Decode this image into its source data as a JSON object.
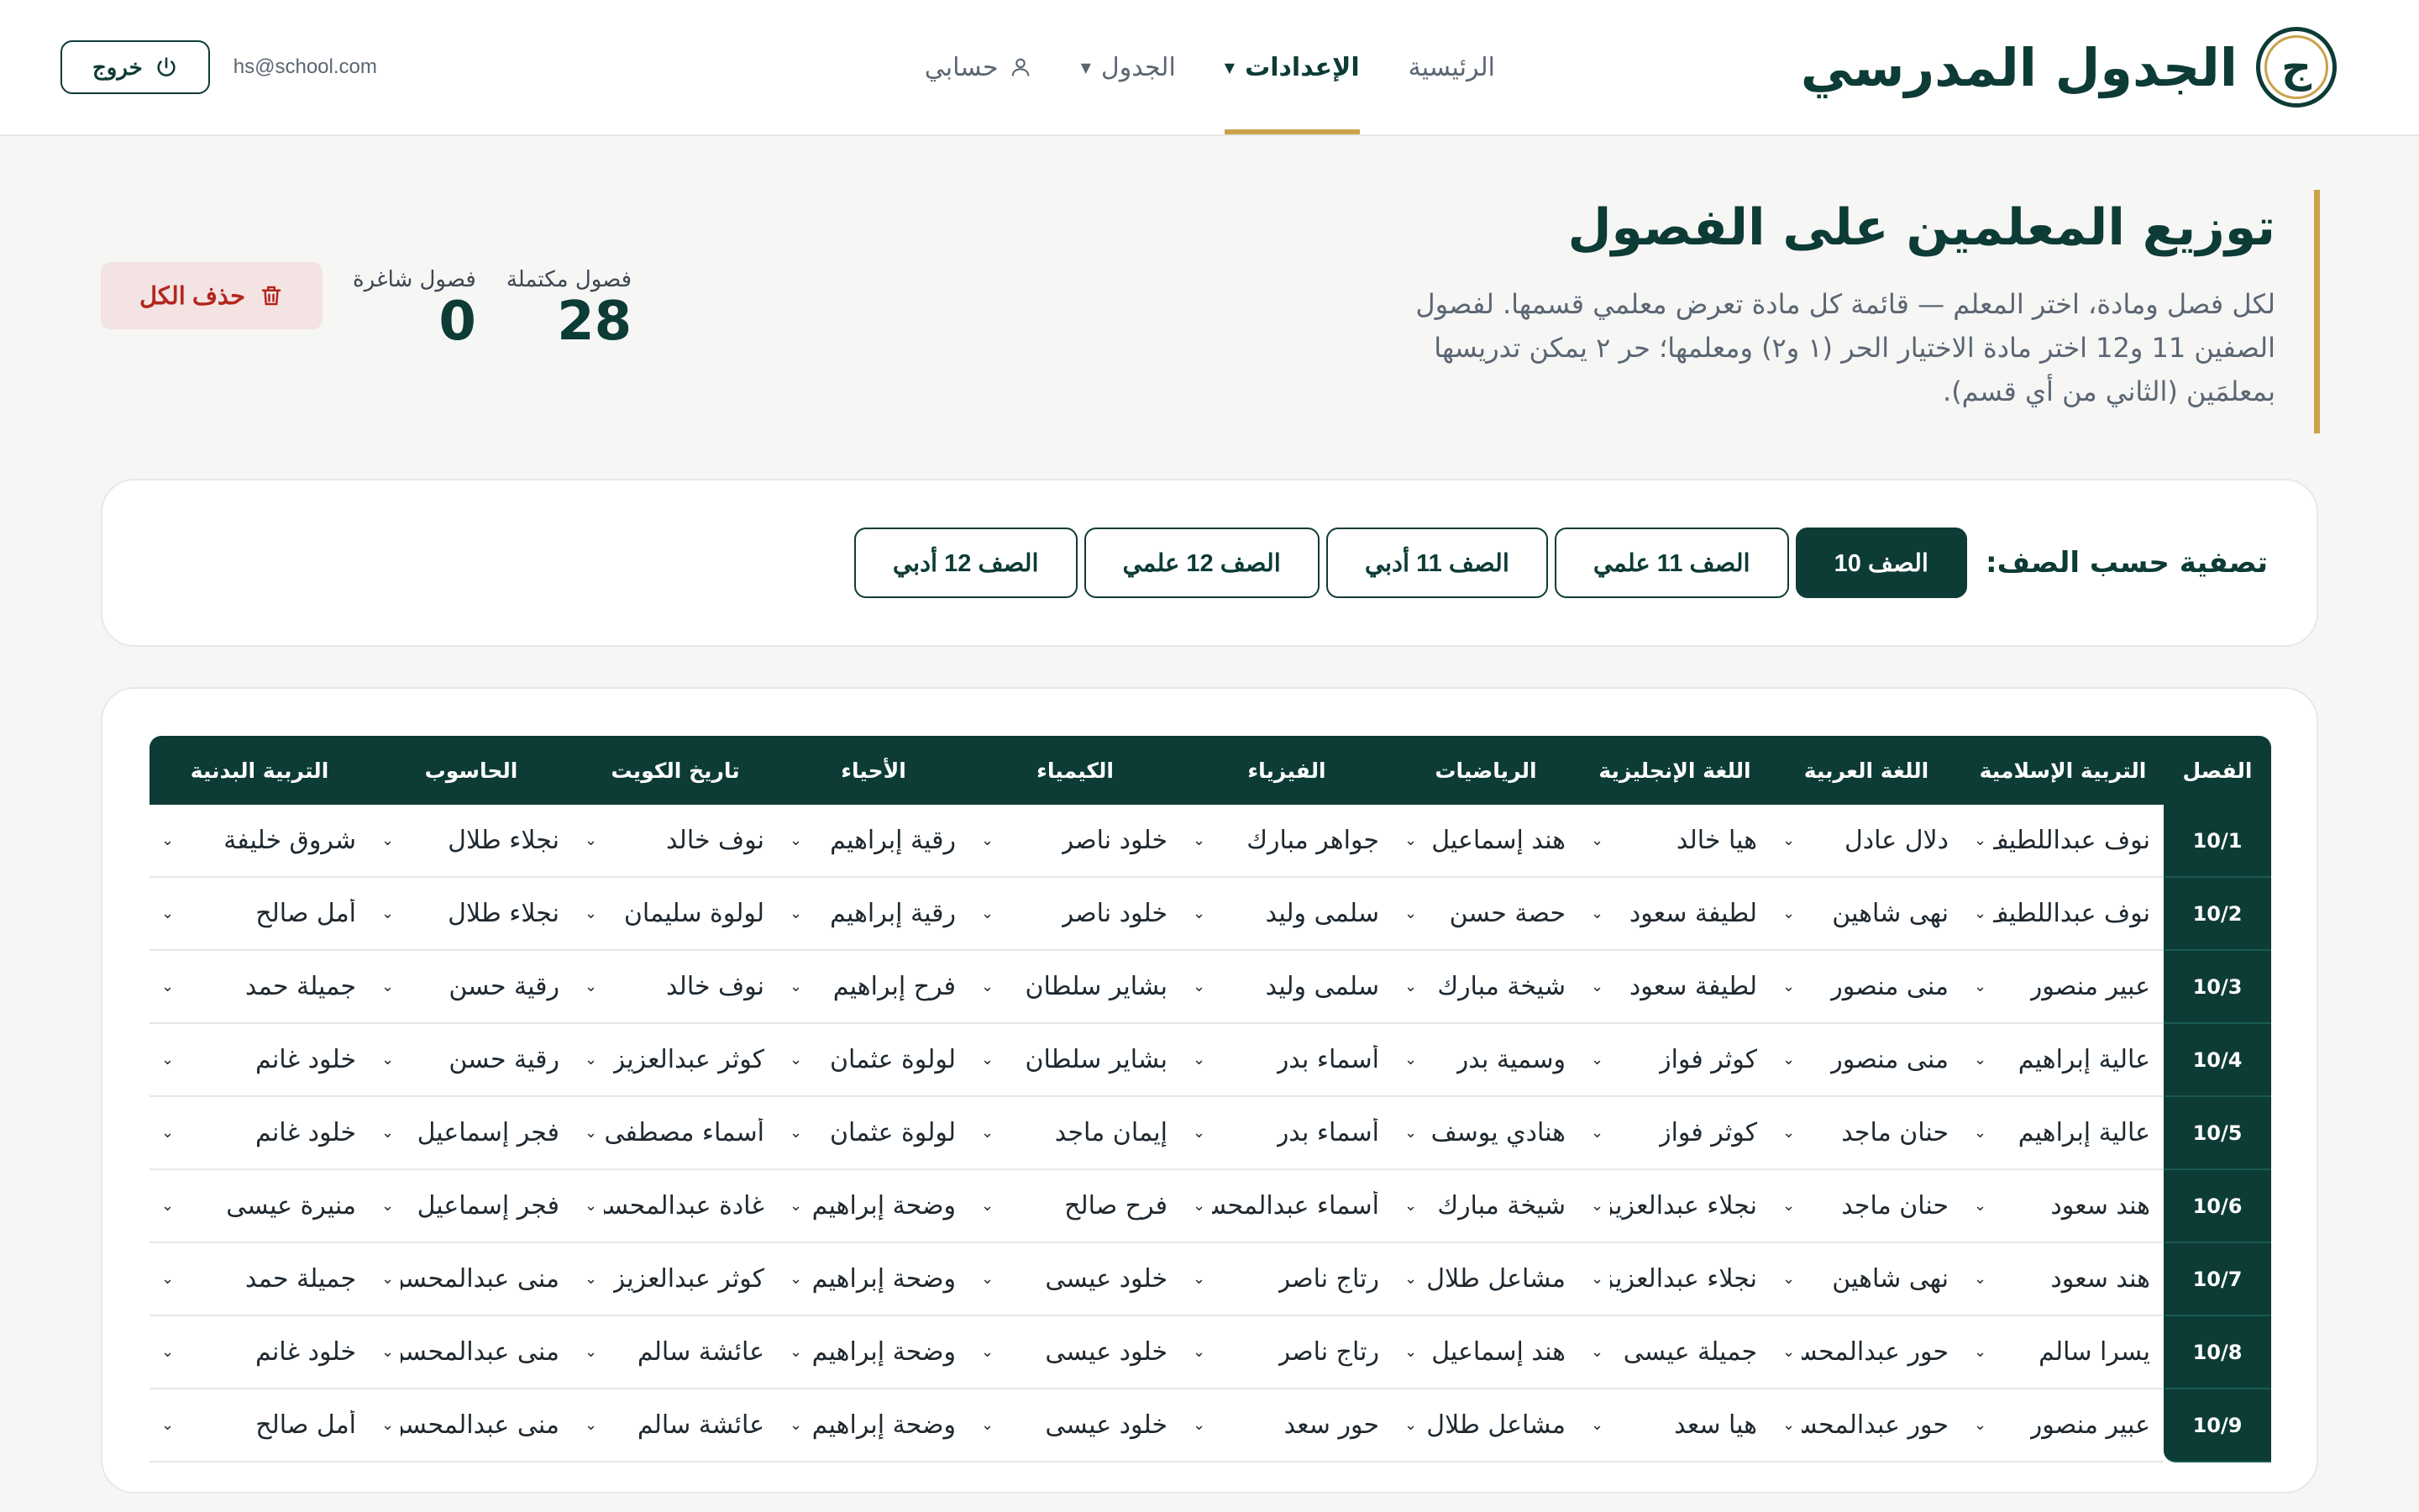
{
  "brand": {
    "logo_glyph": "ج",
    "name": "الجدول المدرسي"
  },
  "nav": {
    "home": "الرئيسية",
    "settings": "الإعدادات",
    "schedule": "الجدول",
    "account": "حسابي"
  },
  "user": {
    "email": "hs@school.com",
    "logout": "خروج"
  },
  "page": {
    "title": "توزيع المعلمين على الفصول",
    "description": "لكل فصل ومادة، اختر المعلم — قائمة كل مادة تعرض معلمي قسمها. لفصول الصفين 11 و12 اختر مادة الاختيار الحر (١ و٢) ومعلمها؛ حر ٢ يمكن تدريسها بمعلمَين (الثاني من أي قسم)."
  },
  "stats": {
    "complete_label": "فصول مكتملة",
    "complete_value": "28",
    "vacant_label": "فصول شاغرة",
    "vacant_value": "0",
    "delete_all": "حذف الكل"
  },
  "filter": {
    "label": "تصفية حسب الصف:",
    "options": [
      "الصف 10",
      "الصف 11 علمي",
      "الصف 11 أدبي",
      "الصف 12 علمي",
      "الصف 12 أدبي"
    ],
    "active": 0
  },
  "table": {
    "headers": [
      "الفصل",
      "التربية الإسلامية",
      "اللغة العربية",
      "اللغة الإنجليزية",
      "الرياضيات",
      "الفيزياء",
      "الكيمياء",
      "الأحياء",
      "تاريخ الكويت",
      "الحاسوب",
      "التربية البدنية"
    ],
    "rows": [
      [
        "10/1",
        "نوف عبداللطيف",
        "دلال عادل",
        "هيا خالد",
        "هند إسماعيل",
        "جواهر مبارك",
        "خلود ناصر",
        "رقية إبراهيم",
        "نوف خالد",
        "نجلاء طلال",
        "شروق خليفة"
      ],
      [
        "10/2",
        "نوف عبداللطيف",
        "نهى شاهين",
        "لطيفة سعود",
        "حصة حسن",
        "سلمى وليد",
        "خلود ناصر",
        "رقية إبراهيم",
        "لولوة سليمان",
        "نجلاء طلال",
        "أمل صالح"
      ],
      [
        "10/3",
        "عبير منصور",
        "منى منصور",
        "لطيفة سعود",
        "شيخة مبارك",
        "سلمى وليد",
        "بشاير سلطان",
        "فرح إبراهيم",
        "نوف خالد",
        "رقية حسن",
        "جميلة حمد"
      ],
      [
        "10/4",
        "عالية إبراهيم",
        "منى منصور",
        "كوثر فواز",
        "وسمية بدر",
        "أسماء بدر",
        "بشاير سلطان",
        "لولوة عثمان",
        "كوثر عبدالعزيز",
        "رقية حسن",
        "خلود غانم"
      ],
      [
        "10/5",
        "عالية إبراهيم",
        "حنان ماجد",
        "كوثر فواز",
        "هنادي يوسف",
        "أسماء بدر",
        "إيمان ماجد",
        "لولوة عثمان",
        "أسماء مصطفى",
        "فجر إسماعيل",
        "خلود غانم"
      ],
      [
        "10/6",
        "هند سعود",
        "حنان ماجد",
        "نجلاء عبدالعزيز",
        "شيخة مبارك",
        "أسماء عبدالمحسن",
        "فرح صالح",
        "وضحة إبراهيم",
        "غادة عبدالمحسن",
        "فجر إسماعيل",
        "منيرة عيسى"
      ],
      [
        "10/7",
        "هند سعود",
        "نهى شاهين",
        "نجلاء عبدالعزيز",
        "مشاعل طلال",
        "رتاج ناصر",
        "خلود عيسى",
        "وضحة إبراهيم",
        "كوثر عبدالعزيز",
        "منى عبدالمحسن",
        "جميلة حمد"
      ],
      [
        "10/8",
        "يسرا سالم",
        "حور عبدالمحسن",
        "جميلة عيسى",
        "هند إسماعيل",
        "رتاج ناصر",
        "خلود عيسى",
        "وضحة إبراهيم",
        "عائشة سالم",
        "منى عبدالمحسن",
        "خلود غانم"
      ],
      [
        "10/9",
        "عبير منصور",
        "حور عبدالمحسن",
        "هيا سعد",
        "مشاعل طلال",
        "حور سعد",
        "خلود عيسى",
        "وضحة إبراهيم",
        "عائشة سالم",
        "منى عبدالمحسن",
        "أمل صالح"
      ]
    ]
  },
  "colors": {
    "primary": "#0d3b36",
    "accent": "#c9a24a",
    "danger": "#b3261e"
  },
  "icons": {
    "logout": "power-icon",
    "delete": "trash-icon",
    "account": "person-icon",
    "dropdown": "chevron-down-icon"
  }
}
